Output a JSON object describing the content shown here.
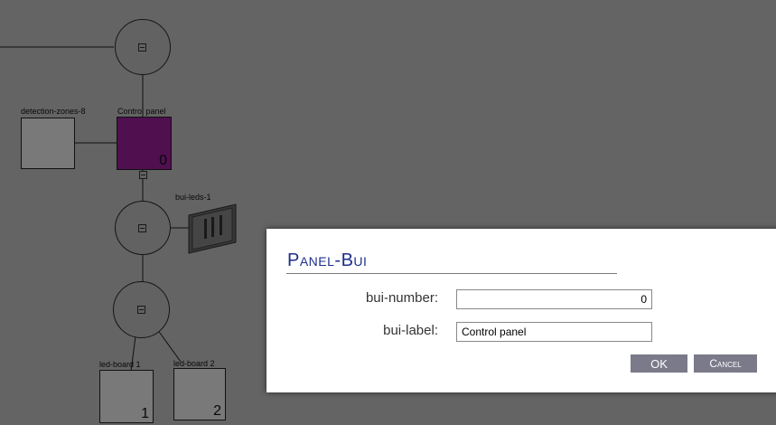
{
  "diagram": {
    "nodes": [
      {
        "label": "detection-zones-8"
      },
      {
        "label": "Control panel",
        "number": "0"
      },
      {
        "label": "bui-leds-1"
      },
      {
        "label": "led-board 1",
        "number": "1"
      },
      {
        "label": "led-board 2",
        "number": "2"
      }
    ]
  },
  "dialog": {
    "title": "Panel-Bui",
    "fields": [
      {
        "label": "bui-number:",
        "value": "0"
      },
      {
        "label": "bui-label:",
        "value": "Control panel"
      }
    ],
    "ok_label": "OK",
    "cancel_label": "Cancel"
  },
  "colors": {
    "control_panel_fill": "#a020a0",
    "title_color": "#1d2f8c",
    "button_color": "#7a7a8a"
  }
}
